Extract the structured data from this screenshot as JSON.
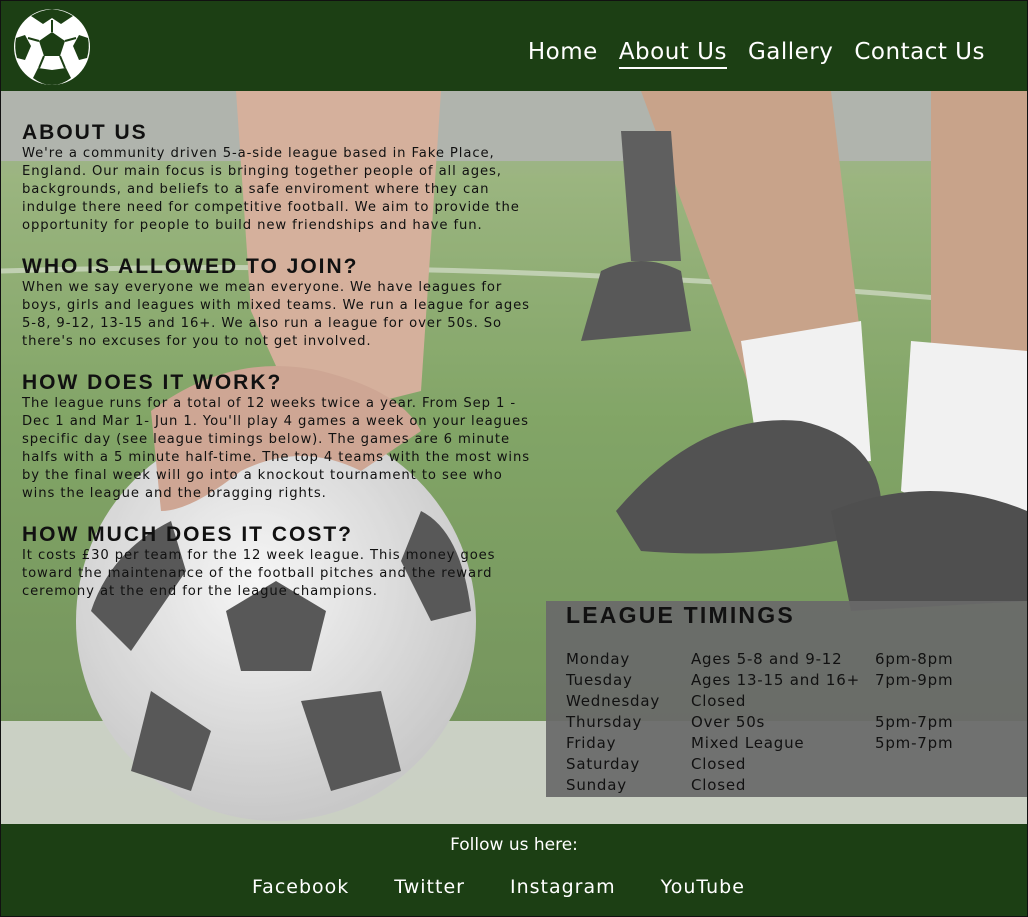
{
  "header": {
    "logo_icon": "soccer-ball-icon",
    "nav": [
      {
        "label": "Home",
        "active": false
      },
      {
        "label": "About Us",
        "active": true
      },
      {
        "label": "Gallery",
        "active": false
      },
      {
        "label": "Contact Us",
        "active": false
      }
    ]
  },
  "sections": [
    {
      "heading": "ABOUT US",
      "text": "We're a community driven 5-a-side league based in Fake Place, England. Our main focus is bringing together people of all ages, backgrounds, and beliefs to a safe enviroment where they can indulge there need for competitive football. We aim to provide the opportunity for people to build new friendships and have fun."
    },
    {
      "heading": "WHO IS ALLOWED TO JOIN?",
      "text": "When we say everyone we mean everyone. We have leagues for boys, girls and leagues with mixed teams. We run a league for ages 5-8, 9-12, 13-15 and 16+. We also run a league for over 50s. So there's no excuses for you to not get involved."
    },
    {
      "heading": "HOW DOES IT WORK?",
      "text": "The league runs for a total of 12 weeks twice a year. From Sep 1 - Dec 1 and Mar 1- Jun 1. You'll play 4 games a week on your leagues specific day (see league timings below). The games are 6 minute halfs with a 5 minute half-time. The top 4 teams with the most wins by the final week will go into a knockout tournament to see who wins the league and the bragging rights."
    },
    {
      "heading": "HOW MUCH DOES IT COST?",
      "text": "It costs £30 per team for the 12 week league. This money goes toward the maintenance of the football pitches and the reward ceremony at the end for the league champions."
    }
  ],
  "timings": {
    "title": "LEAGUE TIMINGS",
    "rows": [
      {
        "day": "Monday",
        "league": "Ages 5-8 and 9-12",
        "time": "6pm-8pm"
      },
      {
        "day": "Tuesday",
        "league": "Ages 13-15 and 16+",
        "time": "7pm-9pm"
      },
      {
        "day": "Wednesday",
        "league": "Closed",
        "time": ""
      },
      {
        "day": "Thursday",
        "league": "Over 50s",
        "time": "5pm-7pm"
      },
      {
        "day": "Friday",
        "league": "Mixed League",
        "time": "5pm-7pm"
      },
      {
        "day": "Saturday",
        "league": "Closed",
        "time": ""
      },
      {
        "day": "Sunday",
        "league": "Closed",
        "time": ""
      }
    ]
  },
  "footer": {
    "follow": "Follow us here:",
    "links": [
      "Facebook",
      "Twitter",
      "Instagram",
      "YouTube"
    ]
  },
  "colors": {
    "header_bg": "#1c3f14",
    "footer_bg": "#1c3f14",
    "timings_bg": "#696969",
    "text": "#111111",
    "nav_text": "#ffffff"
  }
}
